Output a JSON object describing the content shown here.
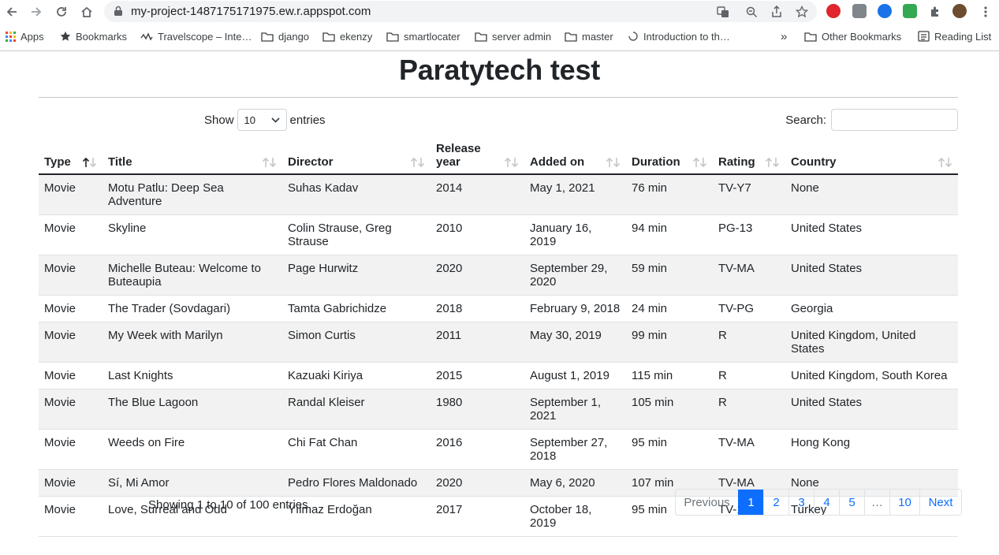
{
  "browser": {
    "url": "my-project-1487175171975.ew.r.appspot.com",
    "bookmarks": [
      {
        "label": "Apps",
        "icon": "apps-grid-icon"
      },
      {
        "label": "Bookmarks",
        "icon": "star-icon"
      },
      {
        "label": "Travelscope – Inte…",
        "icon": "site-icon"
      },
      {
        "label": "django",
        "icon": "folder-icon"
      },
      {
        "label": "ekenzy",
        "icon": "folder-icon"
      },
      {
        "label": "smartlocater",
        "icon": "folder-icon"
      },
      {
        "label": "server admin",
        "icon": "folder-icon"
      },
      {
        "label": "master",
        "icon": "folder-icon"
      },
      {
        "label": "Introduction to th…",
        "icon": "loading-icon"
      }
    ],
    "overflow_label": "»",
    "other_bookmarks": "Other Bookmarks",
    "reading_list": "Reading List",
    "colors": {
      "omnibox": "#f1f3f4",
      "opera": "#e0252d",
      "ext_blue": "#1a73e8",
      "ext_green": "#34a853"
    }
  },
  "page": {
    "title": "Paratytech test",
    "length": {
      "show": "Show",
      "value": "10",
      "entries": "entries"
    },
    "search": {
      "label": "Search:",
      "value": ""
    },
    "columns": [
      "Type",
      "Title",
      "Director",
      "Release year",
      "Added on",
      "Duration",
      "Rating",
      "Country"
    ],
    "rows": [
      [
        "Movie",
        "Motu Patlu: Deep Sea Adventure",
        "Suhas Kadav",
        "2014",
        "May 1, 2021",
        "76 min",
        "TV-Y7",
        "None"
      ],
      [
        "Movie",
        "Skyline",
        "Colin Strause, Greg Strause",
        "2010",
        "January 16, 2019",
        "94 min",
        "PG-13",
        "United States"
      ],
      [
        "Movie",
        "Michelle Buteau: Welcome to Buteaupia",
        "Page Hurwitz",
        "2020",
        "September 29, 2020",
        "59 min",
        "TV-MA",
        "United States"
      ],
      [
        "Movie",
        "The Trader (Sovdagari)",
        "Tamta Gabrichidze",
        "2018",
        "February 9, 2018",
        "24 min",
        "TV-PG",
        "Georgia"
      ],
      [
        "Movie",
        "My Week with Marilyn",
        "Simon Curtis",
        "2011",
        "May 30, 2019",
        "99 min",
        "R",
        "United Kingdom, United States"
      ],
      [
        "Movie",
        "Last Knights",
        "Kazuaki Kiriya",
        "2015",
        "August 1, 2019",
        "115 min",
        "R",
        "United Kingdom, South Korea"
      ],
      [
        "Movie",
        "The Blue Lagoon",
        "Randal Kleiser",
        "1980",
        "September 1, 2021",
        "105 min",
        "R",
        "United States"
      ],
      [
        "Movie",
        "Weeds on Fire",
        "Chi Fat Chan",
        "2016",
        "September 27, 2018",
        "95 min",
        "TV-MA",
        "Hong Kong"
      ],
      [
        "Movie",
        "Sí, Mi Amor",
        "Pedro Flores Maldonado",
        "2020",
        "May 6, 2020",
        "107 min",
        "TV-MA",
        "None"
      ],
      [
        "Movie",
        "Love, Surreal and Odd",
        "Yılmaz Erdoğan",
        "2017",
        "October 18, 2019",
        "95 min",
        "TV-14",
        "Turkey"
      ]
    ],
    "info": "Showing 1 to 10 of 100 entries",
    "pagination": [
      "Previous",
      "1",
      "2",
      "3",
      "4",
      "5",
      "…",
      "10",
      "Next"
    ],
    "active_page": "1",
    "sorted_column": "Type",
    "colors": {
      "link": "#0d6efd",
      "stripe": "#f2f2f2",
      "text": "#212529"
    }
  }
}
